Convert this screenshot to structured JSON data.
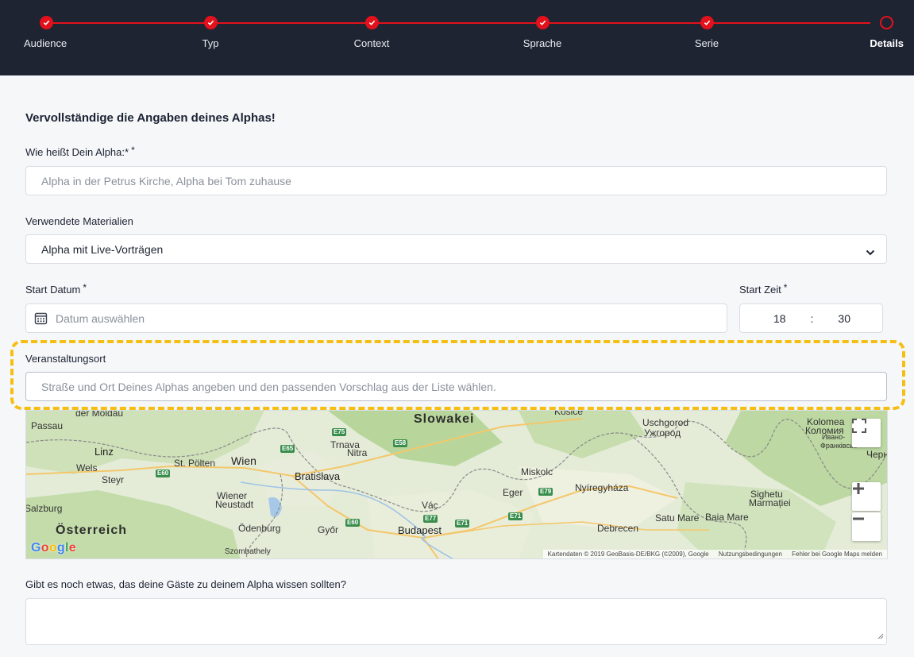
{
  "stepper": {
    "steps": [
      {
        "label": "Audience",
        "done": true
      },
      {
        "label": "Typ",
        "done": true
      },
      {
        "label": "Context",
        "done": true
      },
      {
        "label": "Sprache",
        "done": true
      },
      {
        "label": "Serie",
        "done": true
      },
      {
        "label": "Details",
        "done": false,
        "active": true
      }
    ],
    "accent": "#e3111b",
    "background": "#1f2433"
  },
  "form": {
    "heading": "Vervollständige die Angaben deines Alphas!",
    "name": {
      "label": "Wie heißt Dein Alpha:*",
      "req": "*",
      "placeholder": "Alpha in der Petrus Kirche, Alpha bei Tom zuhause"
    },
    "materials": {
      "label": "Verwendete Materialien",
      "value": "Alpha mit Live-Vorträgen"
    },
    "start_date": {
      "label": "Start Datum",
      "req": "*",
      "placeholder": "Datum auswählen"
    },
    "start_time": {
      "label": "Start Zeit",
      "req": "*",
      "hour": "18",
      "sep": ":",
      "minute": "30"
    },
    "location": {
      "label": "Veranstaltungsort",
      "placeholder": "Straße und Ort Deines Alphas angeben und den passenden Vorschlag aus der Liste wählen."
    },
    "notes": {
      "label": "Gibt es noch etwas, das deine Gäste zu deinem Alpha wissen sollten?",
      "value": ""
    },
    "highlight_color": "#f5be12"
  },
  "map": {
    "labels": {
      "moldau": "der Moldau",
      "passau": "Passau",
      "linz": "Linz",
      "wels": "Wels",
      "steyr": "Steyr",
      "stpoelten": "St. Pölten",
      "wien": "Wien",
      "wiener_neustadt_1": "Wiener",
      "wiener_neustadt_2": "Neustadt",
      "salzburg": "Salzburg",
      "oesterreich": "Österreich",
      "trnava": "Trnava",
      "nitra": "Nitra",
      "bratislava": "Bratislava",
      "slowakei": "Slowakei",
      "kosice": "Košice",
      "uschgorod_1": "Uschgorod",
      "uschgorod_2": "Ужгород",
      "kolomea_1": "Kolomea",
      "kolomea_2": "Коломия",
      "iwano_1": "Ивано-",
      "iwano_2": "Франківськ",
      "czern": "Черн",
      "miskolc": "Miskolc",
      "nyiregyhaza": "Nyíregyháza",
      "eger": "Eger",
      "vac": "Vác",
      "budapest": "Budapest",
      "gyor": "Győr",
      "odenburg": "Ödenburg",
      "debrecen": "Debrecen",
      "satu_mare": "Satu Mare",
      "baia_mare": "Baia Mare",
      "sighetu_1": "Sighetu",
      "sighetu_2": "Marmației",
      "szombathely": "Szombathely",
      "google": "Google"
    },
    "roads": {
      "e75": "E75",
      "e58": "E58",
      "e65": "E65",
      "e60a": "E60",
      "e60b": "E60",
      "e77": "E77",
      "e71a": "E71",
      "e71b": "E71",
      "e79": "E79"
    },
    "attribution": {
      "data": "Kartendaten © 2019 GeoBasis-DE/BKG (©2009), Google",
      "terms": "Nutzungsbedingungen",
      "report": "Fehler bei Google Maps melden"
    },
    "controls": {
      "fullscreen": "fullscreen-icon",
      "zoom_in": "plus-icon",
      "zoom_out": "minus-icon"
    }
  }
}
